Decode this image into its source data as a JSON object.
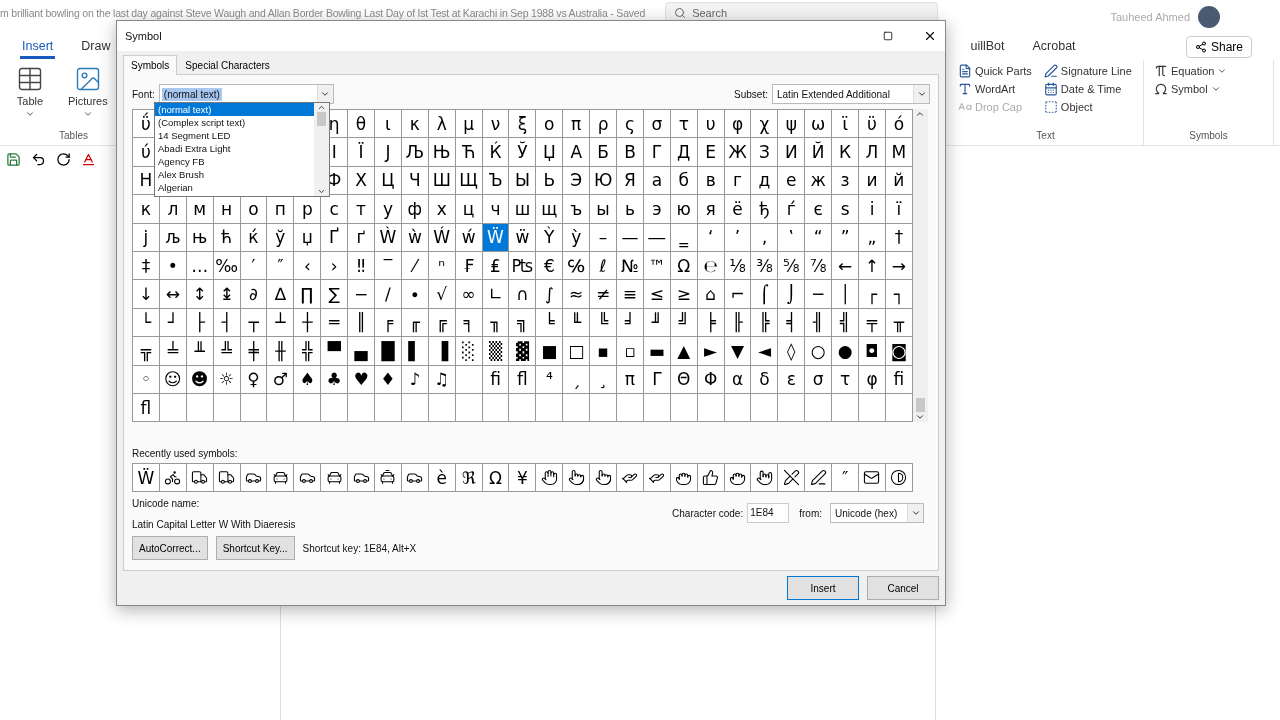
{
  "app": {
    "title": "m brilliant bowling on the last day against Steve Waugh and Allan Border Bowling Last Day of Ist Test at Karachi in Sep 1988 vs Australia  -  Saved",
    "search_placeholder": "Search",
    "user": "Tauheed Ahmed"
  },
  "tabs_left": [
    {
      "label": "Insert",
      "selected": true
    },
    {
      "label": "Draw",
      "selected": false
    }
  ],
  "tabs_right": [
    {
      "label": "uillBot",
      "selected": false
    },
    {
      "label": "Acrobat",
      "selected": false
    }
  ],
  "share": "Share",
  "ribbon_tables": {
    "items": [
      "Table",
      "Pictures"
    ],
    "group": "Tables"
  },
  "ribbon_text": {
    "items": [
      {
        "label": "Quick Parts",
        "disabled": false
      },
      {
        "label": "WordArt",
        "disabled": false
      },
      {
        "label": "Drop Cap",
        "disabled": true
      },
      {
        "label": "Signature Line",
        "disabled": false
      },
      {
        "label": "Date & Time",
        "disabled": false
      },
      {
        "label": "Object",
        "disabled": false
      }
    ],
    "group": "Text"
  },
  "ribbon_symbols": {
    "items": [
      "Equation",
      "Symbol"
    ],
    "group": "Symbols"
  },
  "dialog": {
    "title": "Symbol",
    "tabs": [
      {
        "label": "Symbols",
        "selected": true
      },
      {
        "label": "Special Characters",
        "selected": false
      }
    ],
    "font_label": "Font:",
    "font_value": "(normal text)",
    "font_options": [
      {
        "label": "(normal text)",
        "selected": true
      },
      {
        "label": "(Complex script text)",
        "selected": false
      },
      {
        "label": "14 Segment LED",
        "selected": false
      },
      {
        "label": "Abadi Extra Light",
        "selected": false
      },
      {
        "label": "Agency FB",
        "selected": false
      },
      {
        "label": "Alex Brush",
        "selected": false
      },
      {
        "label": "Algerian",
        "selected": false
      }
    ],
    "subset_label": "Subset:",
    "subset_value": "Latin Extended Additional",
    "grid": [
      {
        "lead": [
          {
            "c": "ΰ",
            "selected": false
          }
        ],
        "trail": [
          {
            "c": "η",
            "selected": false
          },
          {
            "c": "θ",
            "selected": false
          },
          {
            "c": "ι",
            "selected": false
          },
          {
            "c": "κ",
            "selected": false
          },
          {
            "c": "λ",
            "selected": false
          },
          {
            "c": "μ",
            "selected": false
          },
          {
            "c": "ν",
            "selected": false
          },
          {
            "c": "ξ",
            "selected": false
          },
          {
            "c": "ο",
            "selected": false
          },
          {
            "c": "π",
            "selected": false
          },
          {
            "c": "ρ",
            "selected": false
          },
          {
            "c": "ς",
            "selected": false
          },
          {
            "c": "σ",
            "selected": false
          },
          {
            "c": "τ",
            "selected": false
          },
          {
            "c": "υ",
            "selected": false
          },
          {
            "c": "φ",
            "selected": false
          },
          {
            "c": "χ",
            "selected": false
          },
          {
            "c": "ψ",
            "selected": false
          },
          {
            "c": "ω",
            "selected": false
          },
          {
            "c": "ϊ",
            "selected": false
          },
          {
            "c": "ϋ",
            "selected": false
          },
          {
            "c": "ό",
            "selected": false
          }
        ]
      },
      {
        "lead": [
          {
            "c": "ύ",
            "selected": false
          }
        ],
        "trail": [
          {
            "c": "І",
            "selected": false
          },
          {
            "c": "Ї",
            "selected": false
          },
          {
            "c": "Ј",
            "selected": false
          },
          {
            "c": "Љ",
            "selected": false
          },
          {
            "c": "Њ",
            "selected": false
          },
          {
            "c": "Ћ",
            "selected": false
          },
          {
            "c": "Ќ",
            "selected": false
          },
          {
            "c": "Ў",
            "selected": false
          },
          {
            "c": "Џ",
            "selected": false
          },
          {
            "c": "А",
            "selected": false
          },
          {
            "c": "Б",
            "selected": false
          },
          {
            "c": "В",
            "selected": false
          },
          {
            "c": "Г",
            "selected": false
          },
          {
            "c": "Д",
            "selected": false
          },
          {
            "c": "Е",
            "selected": false
          },
          {
            "c": "Ж",
            "selected": false
          },
          {
            "c": "З",
            "selected": false
          },
          {
            "c": "И",
            "selected": false
          },
          {
            "c": "Й",
            "selected": false
          },
          {
            "c": "К",
            "selected": false
          },
          {
            "c": "Л",
            "selected": false
          },
          {
            "c": "М",
            "selected": false
          }
        ]
      },
      {
        "lead": [
          {
            "c": "Н",
            "selected": false
          }
        ],
        "trail": [
          {
            "c": "Ф",
            "selected": false
          },
          {
            "c": "Х",
            "selected": false
          },
          {
            "c": "Ц",
            "selected": false
          },
          {
            "c": "Ч",
            "selected": false
          },
          {
            "c": "Ш",
            "selected": false
          },
          {
            "c": "Щ",
            "selected": false
          },
          {
            "c": "Ъ",
            "selected": false
          },
          {
            "c": "Ы",
            "selected": false
          },
          {
            "c": "Ь",
            "selected": false
          },
          {
            "c": "Э",
            "selected": false
          },
          {
            "c": "Ю",
            "selected": false
          },
          {
            "c": "Я",
            "selected": false
          },
          {
            "c": "а",
            "selected": false
          },
          {
            "c": "б",
            "selected": false
          },
          {
            "c": "в",
            "selected": false
          },
          {
            "c": "г",
            "selected": false
          },
          {
            "c": "д",
            "selected": false
          },
          {
            "c": "е",
            "selected": false
          },
          {
            "c": "ж",
            "selected": false
          },
          {
            "c": "з",
            "selected": false
          },
          {
            "c": "и",
            "selected": false
          },
          {
            "c": "й",
            "selected": false
          }
        ]
      },
      {
        "lead": [
          {
            "c": "к",
            "selected": false
          },
          {
            "c": "л",
            "selected": false
          },
          {
            "c": "м",
            "selected": false
          },
          {
            "c": "н",
            "selected": false
          },
          {
            "c": "о",
            "selected": false
          },
          {
            "c": "п",
            "selected": false
          },
          {
            "c": "р",
            "selected": false
          },
          {
            "c": "с",
            "selected": false
          },
          {
            "c": "т",
            "selected": false
          },
          {
            "c": "у",
            "selected": false
          },
          {
            "c": "ф",
            "selected": false
          },
          {
            "c": "х",
            "selected": false
          },
          {
            "c": "ц",
            "selected": false
          },
          {
            "c": "ч",
            "selected": false
          },
          {
            "c": "ш",
            "selected": false
          },
          {
            "c": "щ",
            "selected": false
          },
          {
            "c": "ъ",
            "selected": false
          },
          {
            "c": "ы",
            "selected": false
          },
          {
            "c": "ь",
            "selected": false
          },
          {
            "c": "э",
            "selected": false
          },
          {
            "c": "ю",
            "selected": false
          },
          {
            "c": "я",
            "selected": false
          },
          {
            "c": "ё",
            "selected": false
          },
          {
            "c": "ђ",
            "selected": false
          },
          {
            "c": "ѓ",
            "selected": false
          },
          {
            "c": "є",
            "selected": false
          },
          {
            "c": "ѕ",
            "selected": false
          },
          {
            "c": "і",
            "selected": false
          },
          {
            "c": "ї",
            "selected": false
          }
        ]
      },
      {
        "lead": [
          {
            "c": "ј",
            "selected": false
          },
          {
            "c": "љ",
            "selected": false
          },
          {
            "c": "њ",
            "selected": false
          },
          {
            "c": "ћ",
            "selected": false
          },
          {
            "c": "ќ",
            "selected": false
          },
          {
            "c": "ў",
            "selected": false
          },
          {
            "c": "џ",
            "selected": false
          },
          {
            "c": "Ґ",
            "selected": false
          },
          {
            "c": "ґ",
            "selected": false
          },
          {
            "c": "Ẁ",
            "selected": false
          },
          {
            "c": "ẁ",
            "selected": false
          },
          {
            "c": "Ẃ",
            "selected": false
          },
          {
            "c": "ẃ",
            "selected": false
          },
          {
            "c": "Ẅ",
            "selected": true
          },
          {
            "c": "ẅ",
            "selected": false
          },
          {
            "c": "Ỳ",
            "selected": false
          },
          {
            "c": "ỳ",
            "selected": false
          },
          {
            "c": "–",
            "selected": false
          },
          {
            "c": "—",
            "selected": false
          },
          {
            "c": "―",
            "selected": false
          },
          {
            "c": "‗",
            "selected": false
          },
          {
            "c": "‘",
            "selected": false
          },
          {
            "c": "’",
            "selected": false
          },
          {
            "c": "‚",
            "selected": false
          },
          {
            "c": "‛",
            "selected": false
          },
          {
            "c": "“",
            "selected": false
          },
          {
            "c": "”",
            "selected": false
          },
          {
            "c": "„",
            "selected": false
          },
          {
            "c": "†",
            "selected": false
          }
        ]
      },
      {
        "lead": [
          {
            "c": "‡",
            "selected": false
          },
          {
            "c": "•",
            "selected": false
          },
          {
            "c": "…",
            "selected": false
          },
          {
            "c": "‰",
            "selected": false
          },
          {
            "c": "′",
            "selected": false
          },
          {
            "c": "″",
            "selected": false
          },
          {
            "c": "‹",
            "selected": false
          },
          {
            "c": "›",
            "selected": false
          },
          {
            "c": "‼",
            "selected": false
          },
          {
            "c": "‾",
            "selected": false
          },
          {
            "c": "⁄",
            "selected": false
          },
          {
            "c": "ⁿ",
            "selected": false
          },
          {
            "c": "₣",
            "selected": false
          },
          {
            "c": "₤",
            "selected": false
          },
          {
            "c": "₧",
            "selected": false
          },
          {
            "c": "€",
            "selected": false
          },
          {
            "c": "℅",
            "selected": false
          },
          {
            "c": "ℓ",
            "selected": false
          },
          {
            "c": "№",
            "selected": false
          },
          {
            "c": "™",
            "selected": false
          },
          {
            "c": "Ω",
            "selected": false
          },
          {
            "c": "℮",
            "selected": false
          },
          {
            "c": "⅛",
            "selected": false
          },
          {
            "c": "⅜",
            "selected": false
          },
          {
            "c": "⅝",
            "selected": false
          },
          {
            "c": "⅞",
            "selected": false
          },
          {
            "c": "←",
            "selected": false
          },
          {
            "c": "↑",
            "selected": false
          },
          {
            "c": "→",
            "selected": false
          }
        ]
      },
      {
        "lead": [
          {
            "c": "↓",
            "selected": false
          },
          {
            "c": "↔",
            "selected": false
          },
          {
            "c": "↕",
            "selected": false
          },
          {
            "c": "↨",
            "selected": false
          },
          {
            "c": "∂",
            "selected": false
          },
          {
            "c": "∆",
            "selected": false
          },
          {
            "c": "∏",
            "selected": false
          },
          {
            "c": "∑",
            "selected": false
          },
          {
            "c": "−",
            "selected": false
          },
          {
            "c": "∕",
            "selected": false
          },
          {
            "c": "∙",
            "selected": false
          },
          {
            "c": "√",
            "selected": false
          },
          {
            "c": "∞",
            "selected": false
          },
          {
            "c": "∟",
            "selected": false
          },
          {
            "c": "∩",
            "selected": false
          },
          {
            "c": "∫",
            "selected": false
          },
          {
            "c": "≈",
            "selected": false
          },
          {
            "c": "≠",
            "selected": false
          },
          {
            "c": "≡",
            "selected": false
          },
          {
            "c": "≤",
            "selected": false
          },
          {
            "c": "≥",
            "selected": false
          },
          {
            "c": "⌂",
            "selected": false
          },
          {
            "c": "⌐",
            "selected": false
          },
          {
            "c": "⌠",
            "selected": false
          },
          {
            "c": "⌡",
            "selected": false
          },
          {
            "c": "─",
            "selected": false
          },
          {
            "c": "│",
            "selected": false
          },
          {
            "c": "┌",
            "selected": false
          },
          {
            "c": "┐",
            "selected": false
          }
        ]
      },
      {
        "lead": [
          {
            "c": "└",
            "selected": false
          },
          {
            "c": "┘",
            "selected": false
          },
          {
            "c": "├",
            "selected": false
          },
          {
            "c": "┤",
            "selected": false
          },
          {
            "c": "┬",
            "selected": false
          },
          {
            "c": "┴",
            "selected": false
          },
          {
            "c": "┼",
            "selected": false
          },
          {
            "c": "═",
            "selected": false
          },
          {
            "c": "║",
            "selected": false
          },
          {
            "c": "╒",
            "selected": false
          },
          {
            "c": "╓",
            "selected": false
          },
          {
            "c": "╔",
            "selected": false
          },
          {
            "c": "╕",
            "selected": false
          },
          {
            "c": "╖",
            "selected": false
          },
          {
            "c": "╗",
            "selected": false
          },
          {
            "c": "╘",
            "selected": false
          },
          {
            "c": "╙",
            "selected": false
          },
          {
            "c": "╚",
            "selected": false
          },
          {
            "c": "╛",
            "selected": false
          },
          {
            "c": "╜",
            "selected": false
          },
          {
            "c": "╝",
            "selected": false
          },
          {
            "c": "╞",
            "selected": false
          },
          {
            "c": "╟",
            "selected": false
          },
          {
            "c": "╠",
            "selected": false
          },
          {
            "c": "╡",
            "selected": false
          },
          {
            "c": "╢",
            "selected": false
          },
          {
            "c": "╣",
            "selected": false
          },
          {
            "c": "╤",
            "selected": false
          },
          {
            "c": "╥",
            "selected": false
          }
        ]
      },
      {
        "lead": [
          {
            "c": "╦",
            "selected": false
          },
          {
            "c": "╧",
            "selected": false
          },
          {
            "c": "╨",
            "selected": false
          },
          {
            "c": "╩",
            "selected": false
          },
          {
            "c": "╪",
            "selected": false
          },
          {
            "c": "╫",
            "selected": false
          },
          {
            "c": "╬",
            "selected": false
          },
          {
            "c": "▀",
            "selected": false
          },
          {
            "c": "▄",
            "selected": false
          },
          {
            "c": "█",
            "selected": false
          },
          {
            "c": "▌",
            "selected": false
          },
          {
            "c": "▐",
            "selected": false
          },
          {
            "c": "░",
            "selected": false
          },
          {
            "c": "▒",
            "selected": false
          },
          {
            "c": "▓",
            "selected": false
          },
          {
            "c": "■",
            "selected": false
          },
          {
            "c": "□",
            "selected": false
          },
          {
            "c": "▪",
            "selected": false
          },
          {
            "c": "▫",
            "selected": false
          },
          {
            "c": "▬",
            "selected": false
          },
          {
            "c": "▲",
            "selected": false
          },
          {
            "c": "►",
            "selected": false
          },
          {
            "c": "▼",
            "selected": false
          },
          {
            "c": "◄",
            "selected": false
          },
          {
            "c": "◊",
            "selected": false
          },
          {
            "c": "○",
            "selected": false
          },
          {
            "c": "●",
            "selected": false
          },
          {
            "c": "◘",
            "selected": false
          },
          {
            "c": "◙",
            "selected": false
          }
        ]
      },
      {
        "lead": [
          {
            "c": "◦",
            "selected": false
          },
          {
            "c": "☺",
            "selected": false
          },
          {
            "c": "☻",
            "selected": false
          },
          {
            "c": "☼",
            "selected": false
          },
          {
            "c": "♀",
            "selected": false
          },
          {
            "c": "♂",
            "selected": false
          },
          {
            "c": "♠",
            "selected": false
          },
          {
            "c": "♣",
            "selected": false
          },
          {
            "c": "♥",
            "selected": false
          },
          {
            "c": "♦",
            "selected": false
          },
          {
            "c": "♪",
            "selected": false
          },
          {
            "c": "♫",
            "selected": false
          }
        ],
        "trail": [
          {
            "c": "ﬁ",
            "selected": false
          },
          {
            "c": "ﬂ",
            "selected": false
          },
          {
            "c": "⁴",
            "selected": false
          },
          {
            "c": "ˏ",
            "selected": false
          },
          {
            "c": "¸",
            "selected": false
          },
          {
            "c": "π",
            "selected": false
          },
          {
            "c": "Γ",
            "selected": false
          },
          {
            "c": "Θ",
            "selected": false
          },
          {
            "c": "Φ",
            "selected": false
          },
          {
            "c": "α",
            "selected": false
          },
          {
            "c": "δ",
            "selected": false
          },
          {
            "c": "ε",
            "selected": false
          },
          {
            "c": "σ",
            "selected": false
          },
          {
            "c": "τ",
            "selected": false
          },
          {
            "c": "φ",
            "selected": false
          },
          {
            "c": "ﬁ",
            "selected": false
          }
        ]
      },
      {
        "lead": [
          {
            "c": "ﬂ",
            "selected": false
          }
        ]
      }
    ],
    "recent_label": "Recently used symbols:",
    "recent": [
      {
        "kind": "char",
        "text": "Ẅ"
      },
      {
        "kind": "icon"
      },
      {
        "kind": "icon"
      },
      {
        "kind": "icon"
      },
      {
        "kind": "icon"
      },
      {
        "kind": "icon"
      },
      {
        "kind": "icon"
      },
      {
        "kind": "icon"
      },
      {
        "kind": "icon"
      },
      {
        "kind": "icon"
      },
      {
        "kind": "icon"
      },
      {
        "kind": "char",
        "text": "è"
      },
      {
        "kind": "char",
        "text": "ℜ"
      },
      {
        "kind": "char",
        "text": "Ω"
      },
      {
        "kind": "char",
        "text": "¥"
      },
      {
        "kind": "icon"
      },
      {
        "kind": "icon"
      },
      {
        "kind": "icon"
      },
      {
        "kind": "icon"
      },
      {
        "kind": "icon"
      },
      {
        "kind": "icon"
      },
      {
        "kind": "icon"
      },
      {
        "kind": "icon"
      },
      {
        "kind": "icon"
      },
      {
        "kind": "icon"
      },
      {
        "kind": "icon"
      },
      {
        "kind": "char",
        "text": "″"
      },
      {
        "kind": "icon"
      },
      {
        "kind": "icon"
      }
    ],
    "unicode_name_label": "Unicode name:",
    "unicode_name": "Latin Capital Letter W With Diaeresis",
    "char_code_label": "Character code:",
    "char_code": "1E84",
    "from_label": "from:",
    "from_value": "Unicode (hex)",
    "autocorrect": "AutoCorrect...",
    "shortcut_button": "Shortcut Key...",
    "shortcut_text": "Shortcut key: 1E84, Alt+X",
    "buttons": [
      "Insert",
      "Cancel"
    ]
  }
}
